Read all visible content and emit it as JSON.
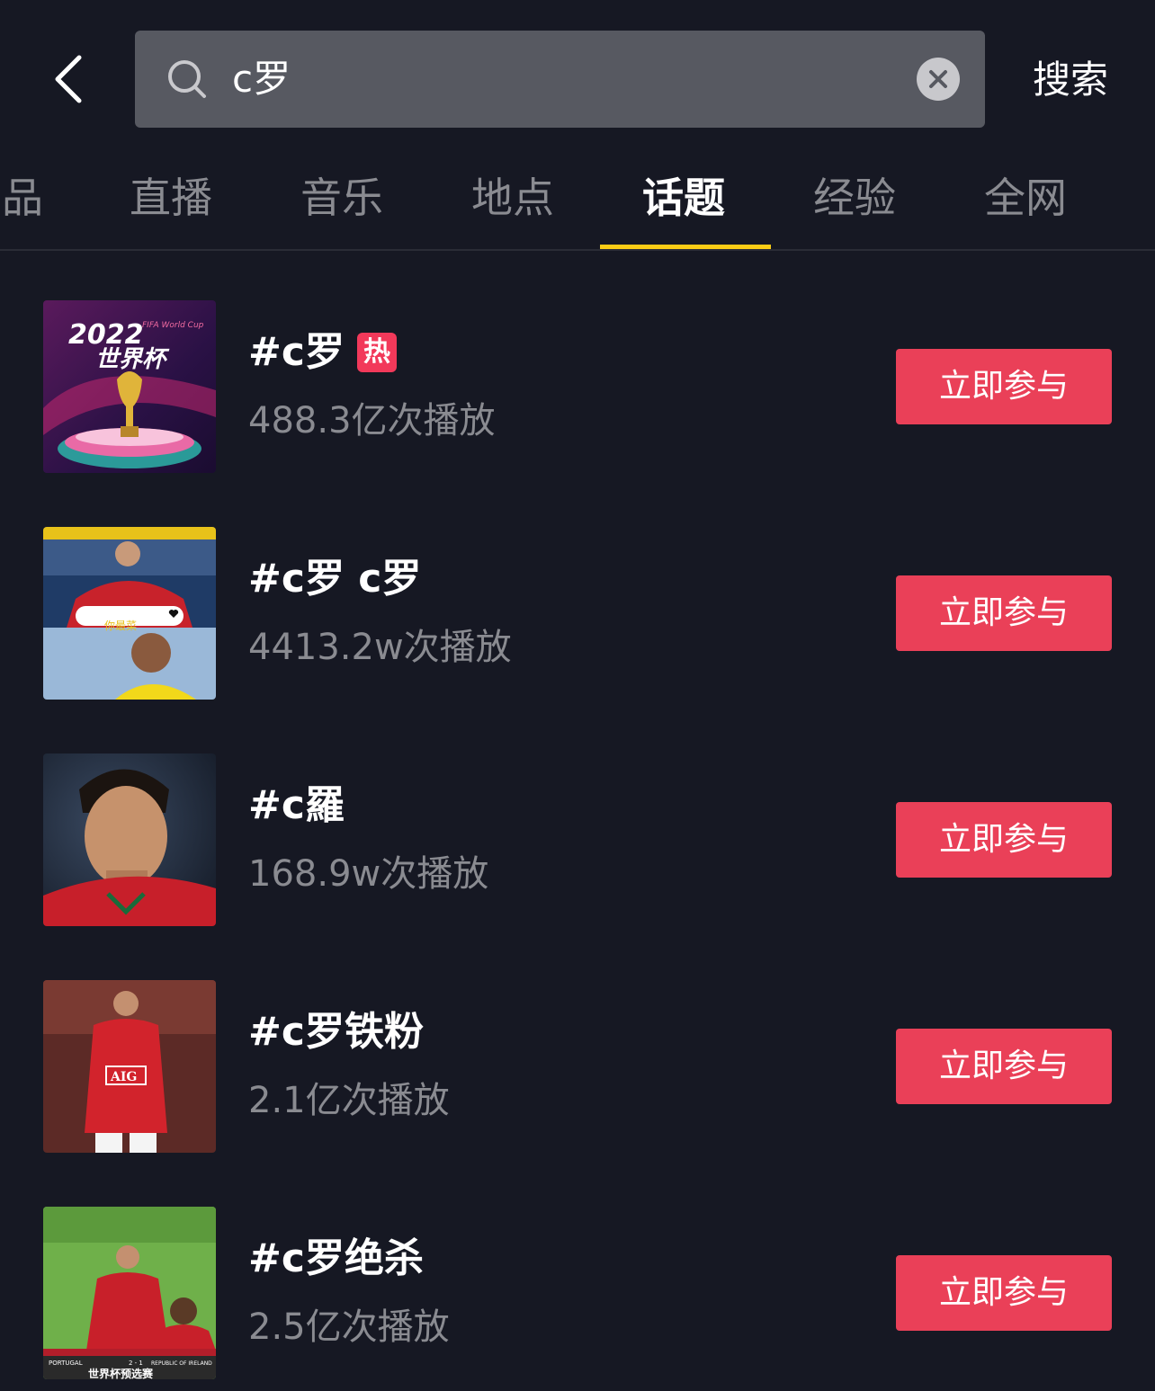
{
  "header": {
    "search_query": "c罗",
    "search_button_label": "搜索"
  },
  "tabs": [
    {
      "label": "品"
    },
    {
      "label": "直播"
    },
    {
      "label": "音乐"
    },
    {
      "label": "地点"
    },
    {
      "label": "话题",
      "active": true
    },
    {
      "label": "经验"
    },
    {
      "label": "全网"
    }
  ],
  "topics": [
    {
      "title": "#c罗",
      "hot_badge": "热",
      "plays": "488.3亿次播放",
      "join_label": "立即参与"
    },
    {
      "title": "#c罗 c罗",
      "plays": "4413.2w次播放",
      "join_label": "立即参与"
    },
    {
      "title": "#c羅",
      "plays": "168.9w次播放",
      "join_label": "立即参与"
    },
    {
      "title": "#c罗铁粉",
      "plays": "2.1亿次播放",
      "join_label": "立即参与"
    },
    {
      "title": "#c罗绝杀",
      "plays": "2.5亿次播放",
      "join_label": "立即参与"
    }
  ],
  "thumbnails": {
    "t1": {
      "year": "2022",
      "caption": "世界杯",
      "small": "FIFA World Cup"
    },
    "t2": {
      "caption": "你最菜"
    },
    "t4": {
      "sponsor": "AIG"
    },
    "t5": {
      "caption": "世界杯预选赛",
      "score": "2 - 1",
      "left_team": "PORTUGAL",
      "right_team": "REPUBLIC OF IRELAND"
    }
  },
  "colors": {
    "background": "#161823",
    "accent_yellow": "#facc15",
    "button_red": "#ea4058",
    "hot_badge": "#f2395a"
  }
}
